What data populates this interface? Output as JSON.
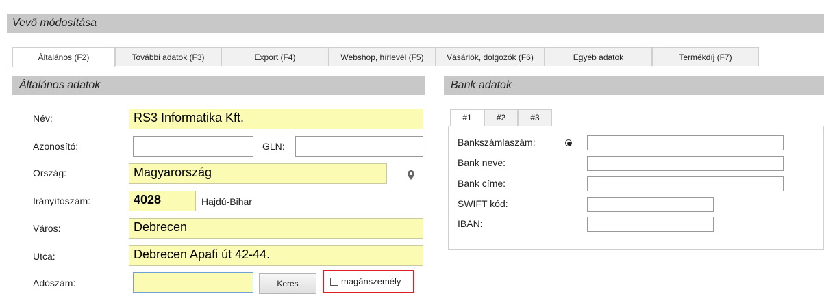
{
  "window": {
    "title": "Vevő módosítása"
  },
  "tabs": [
    {
      "label": "Általános (F2)",
      "active": true
    },
    {
      "label": "További adatok (F3)"
    },
    {
      "label": "Export (F4)"
    },
    {
      "label": "Webshop, hírlevél (F5)"
    },
    {
      "label": "Vásárlók, dolgozók (F6)"
    },
    {
      "label": "Egyéb adatok"
    },
    {
      "label": "Termékdíj (F7)"
    }
  ],
  "general": {
    "header": "Általános adatok",
    "name_label": "Név:",
    "name_value": "RS3 Informatika Kft.",
    "id_label": "Azonosító:",
    "id_value": "",
    "gln_label": "GLN:",
    "gln_value": "",
    "country_label": "Ország:",
    "country_value": "Magyarország",
    "zip_label": "Irányítószám:",
    "zip_value": "4028",
    "county": "Hajdú-Bihar",
    "city_label": "Város:",
    "city_value": "Debrecen",
    "street_label": "Utca:",
    "street_value": "Debrecen Apafi út 42-44.",
    "tax_label": "Adószám:",
    "tax_value": "",
    "search_button": "Keres",
    "private_person": "magánszemély"
  },
  "bank": {
    "header": "Bank adatok",
    "tabs": [
      "#1",
      "#2",
      "#3"
    ],
    "account_label": "Bankszámlaszám:",
    "bank_name_label": "Bank neve:",
    "bank_address_label": "Bank címe:",
    "swift_label": "SWIFT kód:",
    "iban_label": "IBAN:"
  },
  "icons": {
    "location": "map-pin-icon",
    "radio": "radio-selected-icon"
  }
}
